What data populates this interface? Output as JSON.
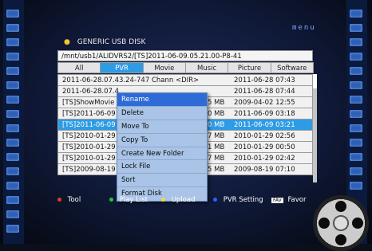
{
  "brand": "menu",
  "title": "GENERIC USB DISK",
  "path": "/mnt/usb1/ALIDVRS2/[TS]2011-06-09.05.21.00-P8-41",
  "tabs": [
    {
      "label": "All",
      "active": false
    },
    {
      "label": "PVR",
      "active": true
    },
    {
      "label": "Movie",
      "active": false
    },
    {
      "label": "Music",
      "active": false
    },
    {
      "label": "Picture",
      "active": false
    },
    {
      "label": "Software",
      "active": false
    }
  ],
  "rows": [
    {
      "name": "2011-06-28.07.43.24-747 Chann <DIR>",
      "size": "",
      "date": "2011-06-28 07:43",
      "selected": false
    },
    {
      "name": "2011-06-28.07.4",
      "size": "",
      "date": "2011-06-28 07:44",
      "selected": false
    },
    {
      "name": "[TS]ShowMovie",
      "size": "5 MB",
      "date": "2009-04-02 12:55",
      "selected": false
    },
    {
      "name": "[TS]2011-06-09",
      "size": "0 MB",
      "date": "2011-06-09 03:18",
      "selected": false
    },
    {
      "name": "[TS]2011-06-09",
      "size": "0 MB",
      "date": "2011-06-09 03:21",
      "selected": true
    },
    {
      "name": "[TS]2010-01-29",
      "size": "7 MB",
      "date": "2010-01-29 02:56",
      "selected": false
    },
    {
      "name": "[TS]2010-01-29",
      "size": "1 MB",
      "date": "2010-01-29 00:50",
      "selected": false
    },
    {
      "name": "[TS]2010-01-29",
      "size": "7 MB",
      "date": "2010-01-29 02:42",
      "selected": false
    },
    {
      "name": "[TS]2009-08-19",
      "size": "5 MB",
      "date": "2009-08-19 07:10",
      "selected": false
    }
  ],
  "menu": {
    "items": [
      {
        "label": "Rename",
        "highlighted": true
      },
      {
        "label": "Delete",
        "highlighted": false
      },
      {
        "label": "Move To",
        "highlighted": false
      },
      {
        "label": "Copy To",
        "highlighted": false
      },
      {
        "label": "Create New Folder",
        "highlighted": false
      },
      {
        "label": "Lock File",
        "highlighted": false
      },
      {
        "label": "Sort",
        "highlighted": false
      },
      {
        "label": "Format Disk",
        "highlighted": false
      }
    ]
  },
  "footer": {
    "tool": "Tool",
    "playlist": "Play List",
    "upload": "Upload",
    "pvr": "PVR Setting",
    "fav_key": "FAV",
    "favor": "Favor"
  },
  "colors": {
    "accent": "#2e9be5",
    "red": "#e23b2d",
    "green": "#27c33a",
    "yellow": "#f3d63a",
    "blue": "#2c61ff"
  }
}
